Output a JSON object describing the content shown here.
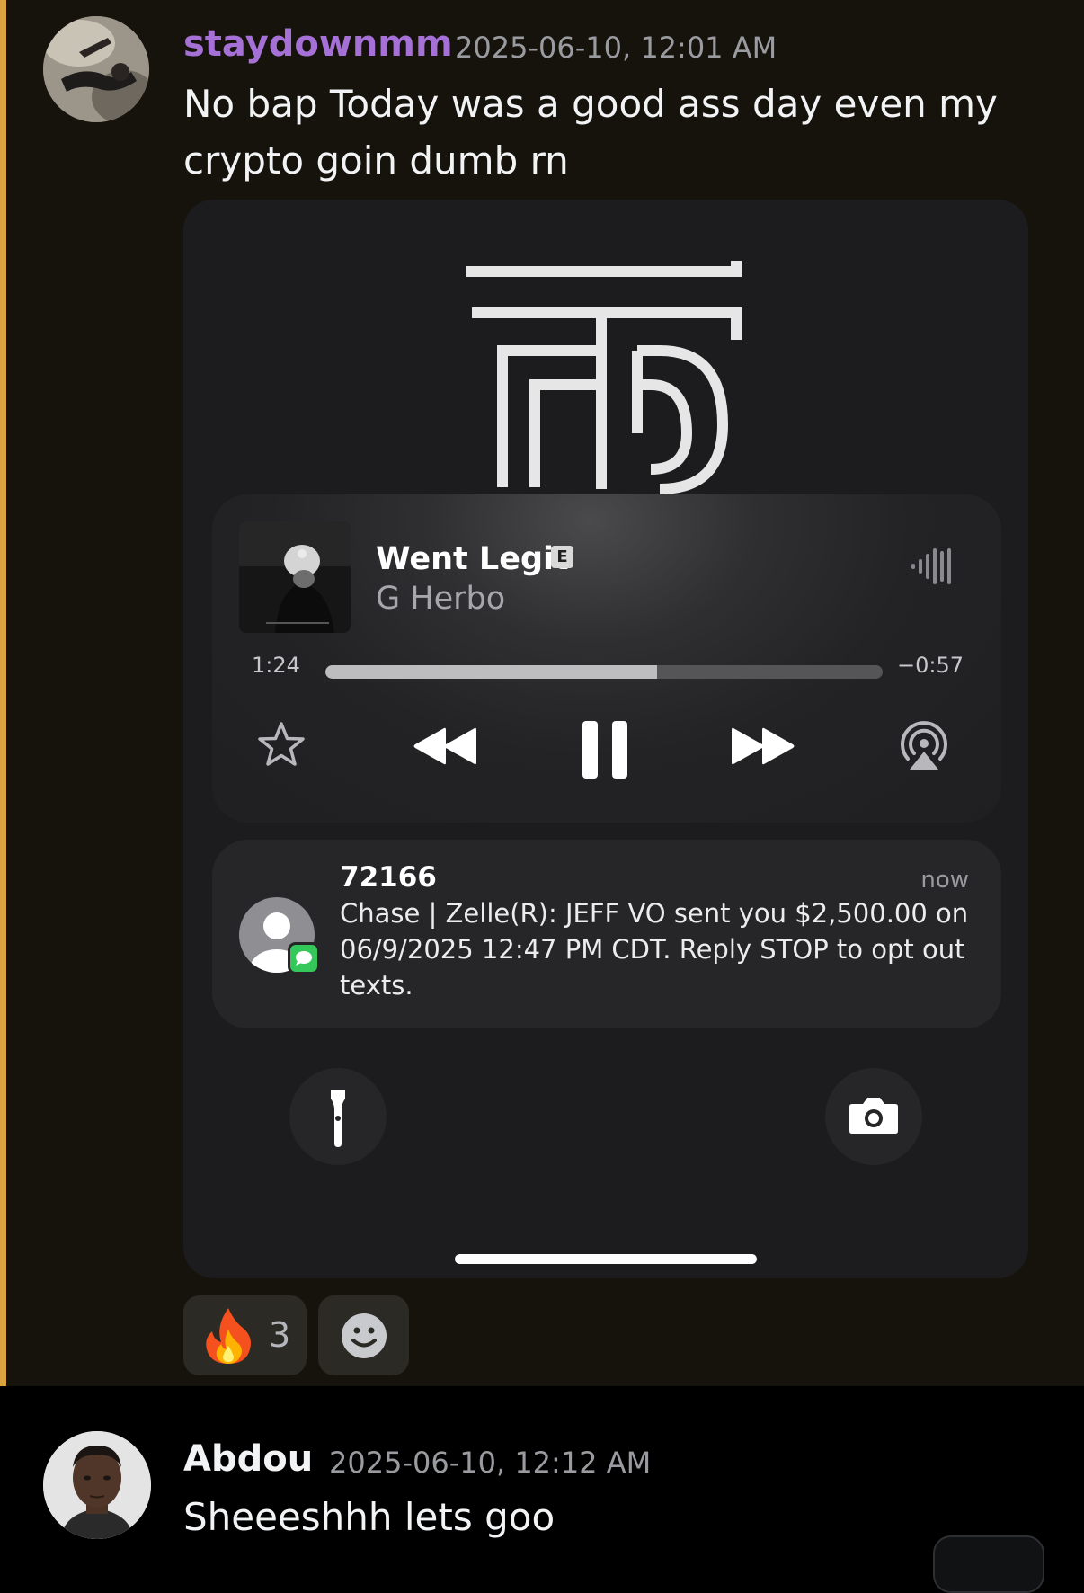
{
  "messages": [
    {
      "username": "staydownmm",
      "username_color": "#a671d6",
      "timestamp": "2025-06-10, 12:01 AM",
      "text_line1": "No bap Today was a good ass day even my",
      "text_line2": "crypto goin dumb rn"
    },
    {
      "username": "Abdou",
      "username_color": "#f2f3f5",
      "timestamp": "2025-06-10, 12:12 AM",
      "text": "Sheeeshhh lets goo"
    }
  ],
  "attachment": {
    "now_playing": {
      "song_title": "Went Legit",
      "explicit_badge": "E",
      "artist": "G Herbo",
      "elapsed": "1:24",
      "remaining": "−0:57",
      "progress_fraction": 0.595,
      "controls": [
        "star-icon",
        "rewind-icon",
        "pause-icon",
        "fast-forward-icon",
        "airplay-icon"
      ]
    },
    "notification": {
      "sender": "72166",
      "time": "now",
      "body": "Chase | Zelle(R): JEFF VO sent you $2,500.00 on 06/9/2025 12:47 PM CDT. Reply STOP to opt out texts."
    },
    "lockscreen_buttons": [
      "flashlight-icon",
      "camera-icon"
    ]
  },
  "reactions": [
    {
      "emoji": "🔥",
      "count": "3"
    },
    {
      "emoji": "add-reaction-icon"
    }
  ],
  "colors": {
    "highlight_bg": "#16130c",
    "highlight_border": "#d9a33f",
    "timestamp": "#9a9ba0"
  }
}
